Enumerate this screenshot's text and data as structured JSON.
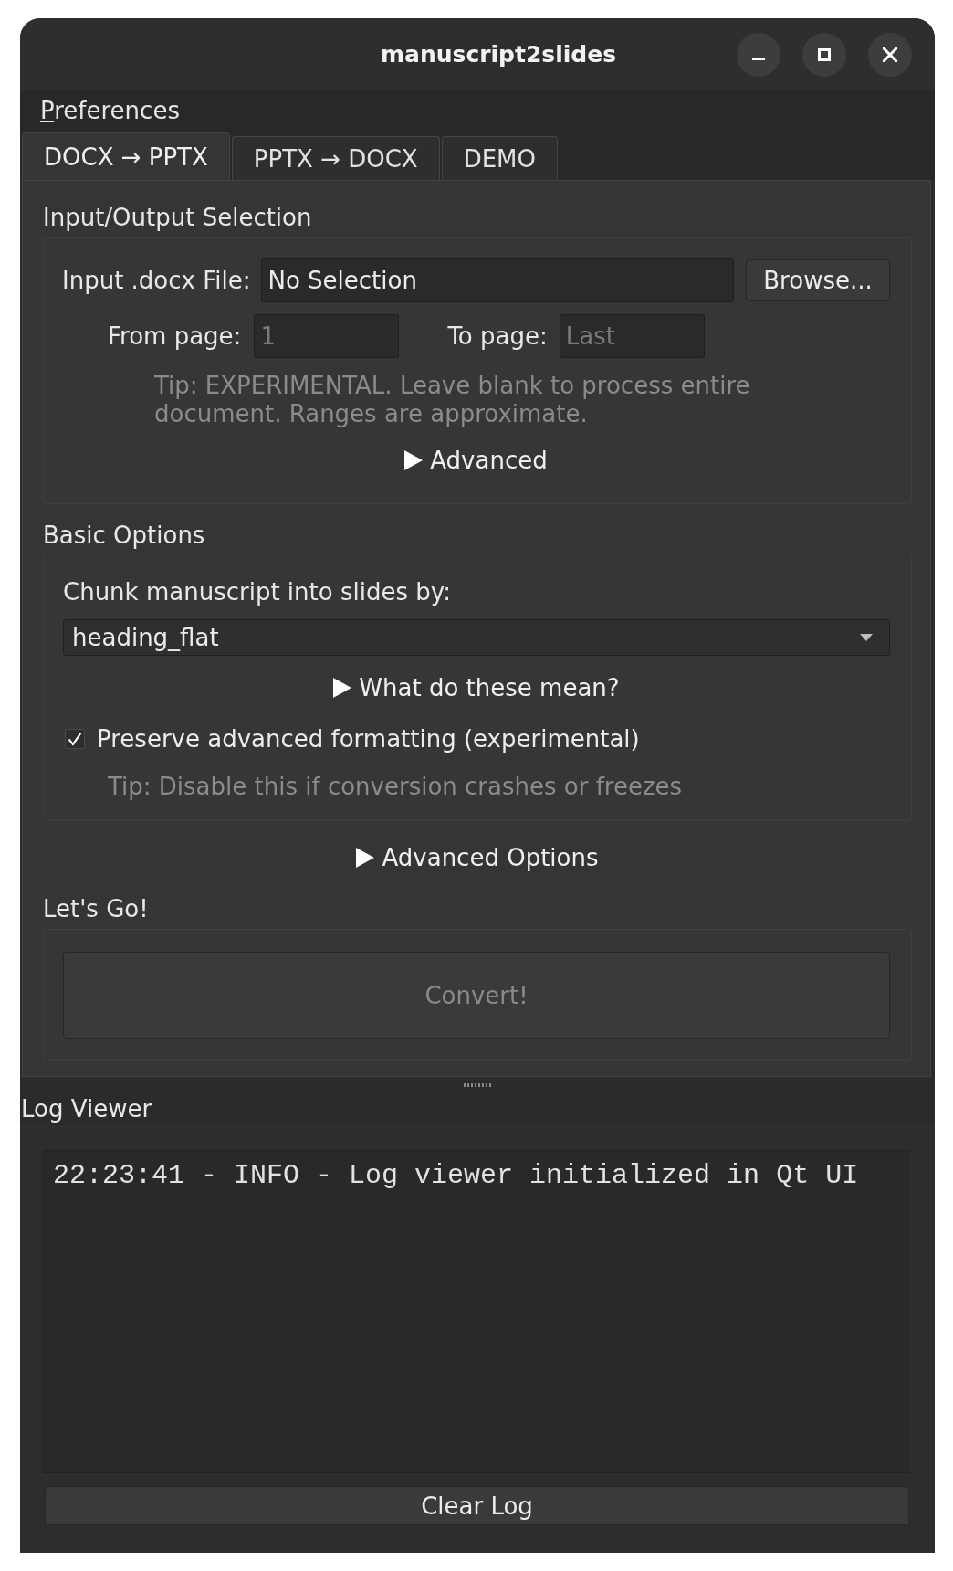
{
  "window": {
    "title": "manuscript2slides"
  },
  "menu_bar": [
    {
      "label": "Preferences"
    }
  ],
  "tabs": [
    {
      "label": "DOCX → PPTX",
      "selected": true
    },
    {
      "label": "PPTX → DOCX",
      "selected": false
    },
    {
      "label": "DEMO",
      "selected": false
    }
  ],
  "input_output": {
    "title": "Input/Output Selection",
    "input_file": {
      "label": "Input .docx File:",
      "value": "No Selection"
    },
    "browse_button": {
      "label": "Browse..."
    },
    "from_page": {
      "label": "From page:",
      "placeholder": "1"
    },
    "to_page": {
      "label": "To page:",
      "placeholder": "Last"
    },
    "tip": "Tip: EXPERIMENTAL. Leave blank to process entire document. Ranges are approximate.",
    "advanced_toggle": {
      "label": "Advanced",
      "expanded": false
    }
  },
  "basic_options": {
    "title": "Basic Options",
    "chunk_label": "Chunk manuscript into slides by:",
    "chunk_select": {
      "value": "heading_flat"
    },
    "help_toggle": {
      "label": "What do these mean?",
      "expanded": false
    },
    "preserve_formatting": {
      "label": "Preserve advanced formatting (experimental)",
      "checked": true
    },
    "tip": "Tip: Disable this if conversion crashes or freezes"
  },
  "advanced_options_toggle": {
    "label": "Advanced Options",
    "expanded": false
  },
  "lets_go": {
    "title": "Let's Go!",
    "convert_button": {
      "label": "Convert!",
      "disabled": true
    }
  },
  "log_viewer": {
    "title": "Log Viewer",
    "lines": [
      "22:23:41 - INFO - Log viewer initialized in Qt UI"
    ],
    "clear_button": {
      "label": "Clear Log"
    }
  }
}
